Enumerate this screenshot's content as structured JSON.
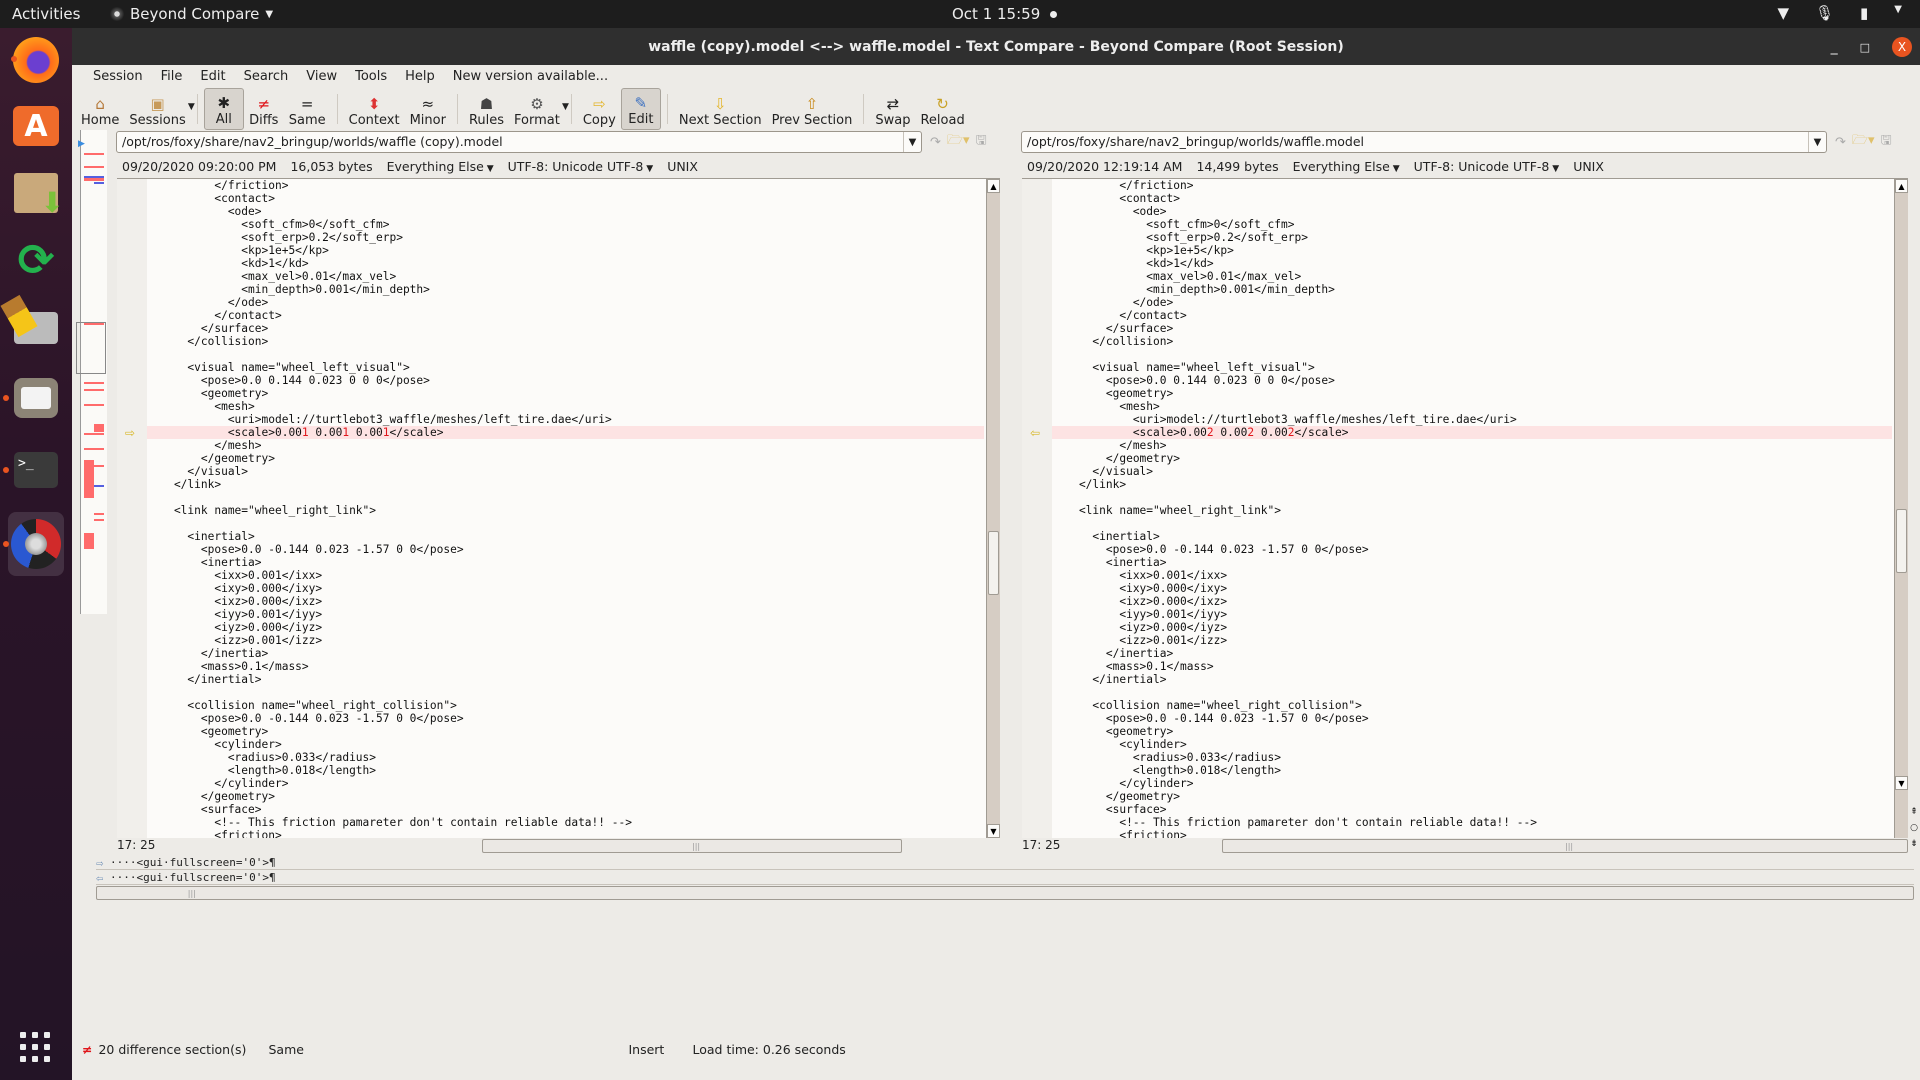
{
  "topbar": {
    "activities": "Activities",
    "app_name": "Beyond Compare",
    "clock": "Oct 1  15:59",
    "tray_icons": [
      "wifi-icon",
      "microphone-icon",
      "battery-icon",
      "system-menu-icon"
    ]
  },
  "dock": {
    "items": [
      {
        "name": "firefox",
        "icon": "firefox-icon",
        "running": true
      },
      {
        "name": "software",
        "icon": "software-store-icon",
        "running": false
      },
      {
        "name": "package-installer",
        "icon": "package-icon",
        "running": false
      },
      {
        "name": "software-updater",
        "icon": "sync-icon",
        "running": false
      },
      {
        "name": "disk-cleaner",
        "icon": "broom-disk-icon",
        "running": false
      },
      {
        "name": "files",
        "icon": "folder-icon",
        "running": true
      },
      {
        "name": "terminal",
        "icon": "terminal-icon",
        "running": true
      },
      {
        "name": "beyond-compare",
        "icon": "beyond-compare-icon",
        "running": true,
        "active": true
      }
    ],
    "show_apps": "show-apps-icon"
  },
  "window": {
    "title": "waffle (copy).model <--> waffle.model - Text Compare - Beyond Compare (Root Session)",
    "controls": {
      "minimize": "_",
      "maximize": "□",
      "close": "X"
    }
  },
  "menu": {
    "items": [
      "Session",
      "File",
      "Edit",
      "Search",
      "View",
      "Tools",
      "Help"
    ],
    "notice": "New version available..."
  },
  "toolbar": {
    "buttons": [
      {
        "label": "Home",
        "icon": "⌂",
        "pressed": false
      },
      {
        "label": "Sessions",
        "icon": "▣",
        "pressed": false,
        "dropdown": true
      },
      {
        "label": "All",
        "icon": "✱",
        "pressed": true
      },
      {
        "label": "Diffs",
        "icon": "≠",
        "pressed": false
      },
      {
        "label": "Same",
        "icon": "=",
        "pressed": false
      },
      {
        "label": "Context",
        "icon": "⬍",
        "pressed": false
      },
      {
        "label": "Minor",
        "icon": "≈",
        "pressed": false
      },
      {
        "label": "Rules",
        "icon": "☗",
        "pressed": false
      },
      {
        "label": "Format",
        "icon": "⚙",
        "pressed": false,
        "dropdown": true
      },
      {
        "label": "Copy",
        "icon": "⇨",
        "pressed": false
      },
      {
        "label": "Edit",
        "icon": "✎",
        "pressed": true
      },
      {
        "label": "Next Section",
        "icon": "⇩",
        "pressed": false
      },
      {
        "label": "Prev Section",
        "icon": "⇧",
        "pressed": false
      },
      {
        "label": "Swap",
        "icon": "⇄",
        "pressed": false
      },
      {
        "label": "Reload",
        "icon": "↻",
        "pressed": false
      }
    ]
  },
  "left": {
    "path": "/opt/ros/foxy/share/nav2_bringup/worlds/waffle (copy).model",
    "date": "09/20/2020 09:20:00 PM",
    "size": "16,053 bytes",
    "format": "Everything Else",
    "encoding": "UTF-8: Unicode UTF-8",
    "line_endings": "UNIX",
    "cursor": "17: 25",
    "diff_arrow": "⇨"
  },
  "right": {
    "path": "/opt/ros/foxy/share/nav2_bringup/worlds/waffle.model",
    "date": "09/20/2020 12:19:14 AM",
    "size": "14,499 bytes",
    "format": "Everything Else",
    "encoding": "UTF-8: Unicode UTF-8",
    "line_endings": "UNIX",
    "cursor": "17: 25",
    "diff_arrow": "⇦"
  },
  "code_left": [
    {
      "t": "          </friction>"
    },
    {
      "t": "          <contact>"
    },
    {
      "t": "            <ode>"
    },
    {
      "t": "              <soft_cfm>0</soft_cfm>"
    },
    {
      "t": "              <soft_erp>0.2</soft_erp>"
    },
    {
      "t": "              <kp>1e+5</kp>"
    },
    {
      "t": "              <kd>1</kd>"
    },
    {
      "t": "              <max_vel>0.01</max_vel>"
    },
    {
      "t": "              <min_depth>0.001</min_depth>"
    },
    {
      "t": "            </ode>"
    },
    {
      "t": "          </contact>"
    },
    {
      "t": "        </surface>"
    },
    {
      "t": "      </collision>"
    },
    {
      "t": ""
    },
    {
      "t": "      <visual name=\"wheel_left_visual\">"
    },
    {
      "t": "        <pose>0.0 0.144 0.023 0 0 0</pose>"
    },
    {
      "t": "        <geometry>"
    },
    {
      "t": "          <mesh>"
    },
    {
      "t": "            <uri>model://turtlebot3_waffle/meshes/left_tire.dae</uri>"
    },
    {
      "t": "            <scale>0.00|1| 0.00|1| 0.00|1|</scale>",
      "diff": true
    },
    {
      "t": "          </mesh>"
    },
    {
      "t": "        </geometry>"
    },
    {
      "t": "      </visual>"
    },
    {
      "t": "    </link>"
    },
    {
      "t": ""
    },
    {
      "t": "    <link name=\"wheel_right_link\">"
    },
    {
      "t": ""
    },
    {
      "t": "      <inertial>"
    },
    {
      "t": "        <pose>0.0 -0.144 0.023 -1.57 0 0</pose>"
    },
    {
      "t": "        <inertia>"
    },
    {
      "t": "          <ixx>0.001</ixx>"
    },
    {
      "t": "          <ixy>0.000</ixy>"
    },
    {
      "t": "          <ixz>0.000</ixz>"
    },
    {
      "t": "          <iyy>0.001</iyy>"
    },
    {
      "t": "          <iyz>0.000</iyz>"
    },
    {
      "t": "          <izz>0.001</izz>"
    },
    {
      "t": "        </inertia>"
    },
    {
      "t": "        <mass>0.1</mass>"
    },
    {
      "t": "      </inertial>"
    },
    {
      "t": ""
    },
    {
      "t": "      <collision name=\"wheel_right_collision\">"
    },
    {
      "t": "        <pose>0.0 -0.144 0.023 -1.57 0 0</pose>"
    },
    {
      "t": "        <geometry>"
    },
    {
      "t": "          <cylinder>"
    },
    {
      "t": "            <radius>0.033</radius>"
    },
    {
      "t": "            <length>0.018</length>"
    },
    {
      "t": "          </cylinder>"
    },
    {
      "t": "        </geometry>"
    },
    {
      "t": "        <surface>"
    },
    {
      "t": "          <!-- This friction pamareter don't contain reliable data!! -->"
    },
    {
      "t": "          <friction>"
    }
  ],
  "code_right": [
    {
      "t": "          </friction>"
    },
    {
      "t": "          <contact>"
    },
    {
      "t": "            <ode>"
    },
    {
      "t": "              <soft_cfm>0</soft_cfm>"
    },
    {
      "t": "              <soft_erp>0.2</soft_erp>"
    },
    {
      "t": "              <kp>1e+5</kp>"
    },
    {
      "t": "              <kd>1</kd>"
    },
    {
      "t": "              <max_vel>0.01</max_vel>"
    },
    {
      "t": "              <min_depth>0.001</min_depth>"
    },
    {
      "t": "            </ode>"
    },
    {
      "t": "          </contact>"
    },
    {
      "t": "        </surface>"
    },
    {
      "t": "      </collision>"
    },
    {
      "t": ""
    },
    {
      "t": "      <visual name=\"wheel_left_visual\">"
    },
    {
      "t": "        <pose>0.0 0.144 0.023 0 0 0</pose>"
    },
    {
      "t": "        <geometry>"
    },
    {
      "t": "          <mesh>"
    },
    {
      "t": "            <uri>model://turtlebot3_waffle/meshes/left_tire.dae</uri>"
    },
    {
      "t": "            <scale>0.00|2| 0.00|2| 0.00|2|</scale>",
      "diff": true
    },
    {
      "t": "          </mesh>"
    },
    {
      "t": "        </geometry>"
    },
    {
      "t": "      </visual>"
    },
    {
      "t": "    </link>"
    },
    {
      "t": ""
    },
    {
      "t": "    <link name=\"wheel_right_link\">"
    },
    {
      "t": ""
    },
    {
      "t": "      <inertial>"
    },
    {
      "t": "        <pose>0.0 -0.144 0.023 -1.57 0 0</pose>"
    },
    {
      "t": "        <inertia>"
    },
    {
      "t": "          <ixx>0.001</ixx>"
    },
    {
      "t": "          <ixy>0.000</ixy>"
    },
    {
      "t": "          <ixz>0.000</ixz>"
    },
    {
      "t": "          <iyy>0.001</iyy>"
    },
    {
      "t": "          <iyz>0.000</iyz>"
    },
    {
      "t": "          <izz>0.001</izz>"
    },
    {
      "t": "        </inertia>"
    },
    {
      "t": "        <mass>0.1</mass>"
    },
    {
      "t": "      </inertial>"
    },
    {
      "t": ""
    },
    {
      "t": "      <collision name=\"wheel_right_collision\">"
    },
    {
      "t": "        <pose>0.0 -0.144 0.023 -1.57 0 0</pose>"
    },
    {
      "t": "        <geometry>"
    },
    {
      "t": "          <cylinder>"
    },
    {
      "t": "            <radius>0.033</radius>"
    },
    {
      "t": "            <length>0.018</length>"
    },
    {
      "t": "          </cylinder>"
    },
    {
      "t": "        </geometry>"
    },
    {
      "t": "        <surface>"
    },
    {
      "t": "          <!-- This friction pamareter don't contain reliable data!! -->"
    },
    {
      "t": "          <friction>"
    }
  ],
  "line_view": {
    "left_line": "····<gui·fullscreen='0'>¶",
    "right_line": "····<gui·fullscreen='0'>¶"
  },
  "status": {
    "diff_count": "20 difference section(s)",
    "current_state": "Same",
    "mode": "Insert",
    "load_time": "Load time: 0.26 seconds"
  },
  "colors": {
    "diff_line_bg": "#fde3e3",
    "diff_char": "#e0161b",
    "overview_red": "#ff6b6b",
    "overview_blue": "#5560e0",
    "accent": "#e95420"
  }
}
